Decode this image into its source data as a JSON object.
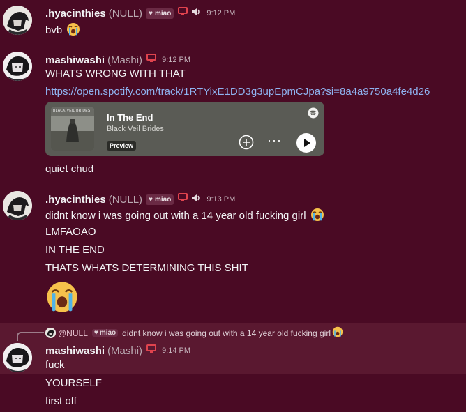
{
  "messages": [
    {
      "username": ".hyacinthies",
      "nick": "(NULL)",
      "tag": "miao",
      "time": "9:12 PM",
      "lines": [
        "bvb"
      ]
    },
    {
      "username": "mashiwashi",
      "nick": "(Mashi)",
      "time": "9:12 PM",
      "lines": [
        "WHATS WRONG WITH THAT",
        "https://open.spotify.com/track/1RTYixE1DD3g3upEpmCJpa?si=8a4a9750a4fe4d26",
        "quiet chud"
      ]
    },
    {
      "username": ".hyacinthies",
      "nick": "(NULL)",
      "tag": "miao",
      "time": "9:13 PM",
      "lines": [
        "didnt know i was going out with a 14 year old fucking girl",
        "LMFAOAO",
        "IN THE END",
        "THATS WHATS DETERMINING THIS SHIT"
      ]
    },
    {
      "username": "mashiwashi",
      "nick": "(Mashi)",
      "time": "9:14 PM",
      "lines": [
        "fuck",
        "YOURSELF",
        "first off"
      ]
    }
  ],
  "reply": {
    "name": "@NULL",
    "tag": "miao",
    "text": "didnt know i was going out with a 14 year old fucking girl"
  },
  "embed": {
    "title": "In The End",
    "artist": "Black Veil Brides",
    "preview_label": "Preview",
    "cover_text": "BLACK VEIL BRIDES",
    "dots": "···"
  },
  "icons": {
    "status_monitor": "monitor-icon",
    "voice": "speaker-icon",
    "emoji": "loudly-crying-face-emoji",
    "service": "spotify-icon"
  },
  "colors": {
    "background": "#4a0a24",
    "highlight": "#5a1830",
    "link": "#8fb3f0",
    "monitor": "#e0434e"
  }
}
